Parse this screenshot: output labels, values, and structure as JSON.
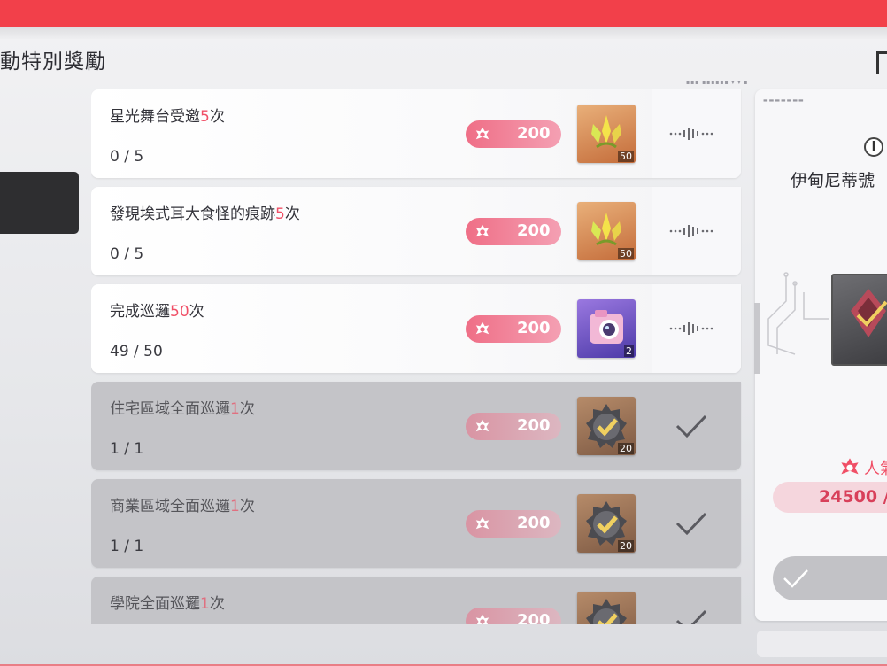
{
  "page": {
    "title": "動特別獎勵"
  },
  "tasks": [
    {
      "name_pre": "星光舞台受邀",
      "name_num": "5",
      "name_post": "次",
      "progress": "0 / 5",
      "points": "200",
      "reward_qty": "50",
      "reward_icon": "crystal-shard-icon",
      "state": "in-progress"
    },
    {
      "name_pre": "發現埃式耳大食怪的痕跡",
      "name_num": "5",
      "name_post": "次",
      "progress": "0 / 5",
      "points": "200",
      "reward_qty": "50",
      "reward_icon": "crystal-shard-icon",
      "state": "in-progress"
    },
    {
      "name_pre": "完成巡邏",
      "name_num": "50",
      "name_post": "次",
      "progress": "49 / 50",
      "points": "200",
      "reward_qty": "2",
      "reward_icon": "camera-icon",
      "state": "in-progress"
    },
    {
      "name_pre": "住宅區域全面巡邏",
      "name_num": "1",
      "name_post": "次",
      "progress": "1 / 1",
      "points": "200",
      "reward_qty": "20",
      "reward_icon": "check-badge-icon",
      "state": "done"
    },
    {
      "name_pre": "商業區域全面巡邏",
      "name_num": "1",
      "name_post": "次",
      "progress": "1 / 1",
      "points": "200",
      "reward_qty": "20",
      "reward_icon": "check-badge-icon",
      "state": "done"
    },
    {
      "name_pre": "學院全面巡邏",
      "name_num": "1",
      "name_post": "次",
      "progress": "",
      "points": "200",
      "reward_qty": "",
      "reward_icon": "check-badge-icon",
      "state": "done"
    }
  ],
  "side": {
    "title": "伊甸尼蒂號",
    "points_label": "人氣",
    "points_value": "24500 /",
    "info_label": "i"
  },
  "colors": {
    "accent": "#f2404a",
    "highlight": "#f04f66",
    "pill": "#ef6e86"
  }
}
